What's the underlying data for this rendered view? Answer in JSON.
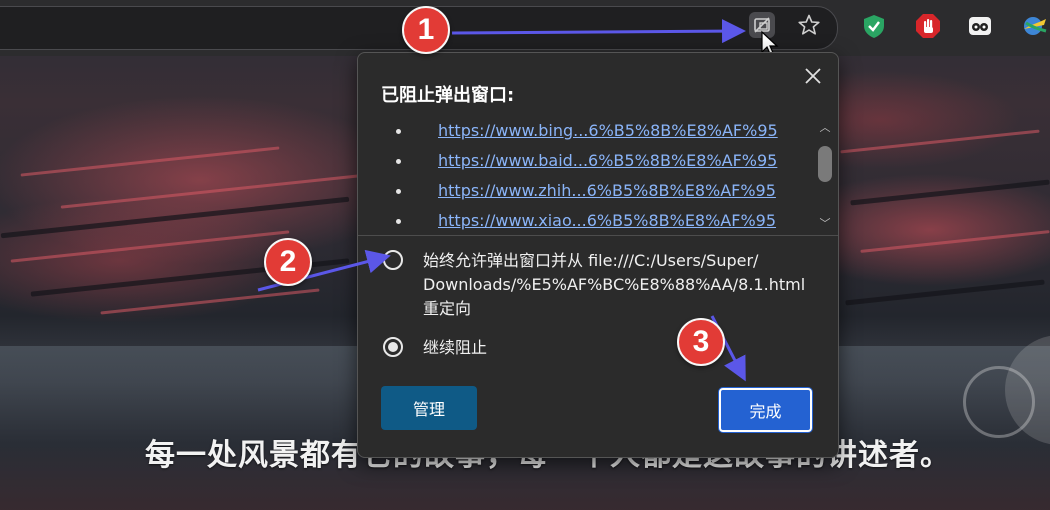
{
  "page": {
    "headline": "每一处风景都有它的故事，每一个人都是这故事的讲述者。"
  },
  "toolbar": {
    "icons": [
      "popup-blocked-icon",
      "star-icon",
      "shield-check-icon",
      "stop-hand-icon",
      "eyes-icon",
      "globe-arrow-icon"
    ]
  },
  "popup": {
    "title": "已阻止弹出窗口:",
    "links": [
      "https://www.bing...6%B5%8B%E8%AF%95",
      "https://www.baid...6%B5%8B%E8%AF%95",
      "https://www.zhih...6%B5%8B%E8%AF%95",
      "https://www.xiao...6%B5%8B%E8%AF%95"
    ],
    "options": {
      "allow_line1": "始终允许弹出窗口并从 file:///C:/Users/Super/",
      "allow_line2": "Downloads/%E5%AF%BC%E8%88%AA/8.1.html",
      "allow_line3": "重定向",
      "block": "继续阻止",
      "selected": "block"
    },
    "manage_label": "管理",
    "done_label": "完成"
  },
  "annotations": {
    "step1": "1",
    "step2": "2",
    "step3": "3",
    "color": "#e23b36",
    "arrow_color": "#5b57e8"
  }
}
